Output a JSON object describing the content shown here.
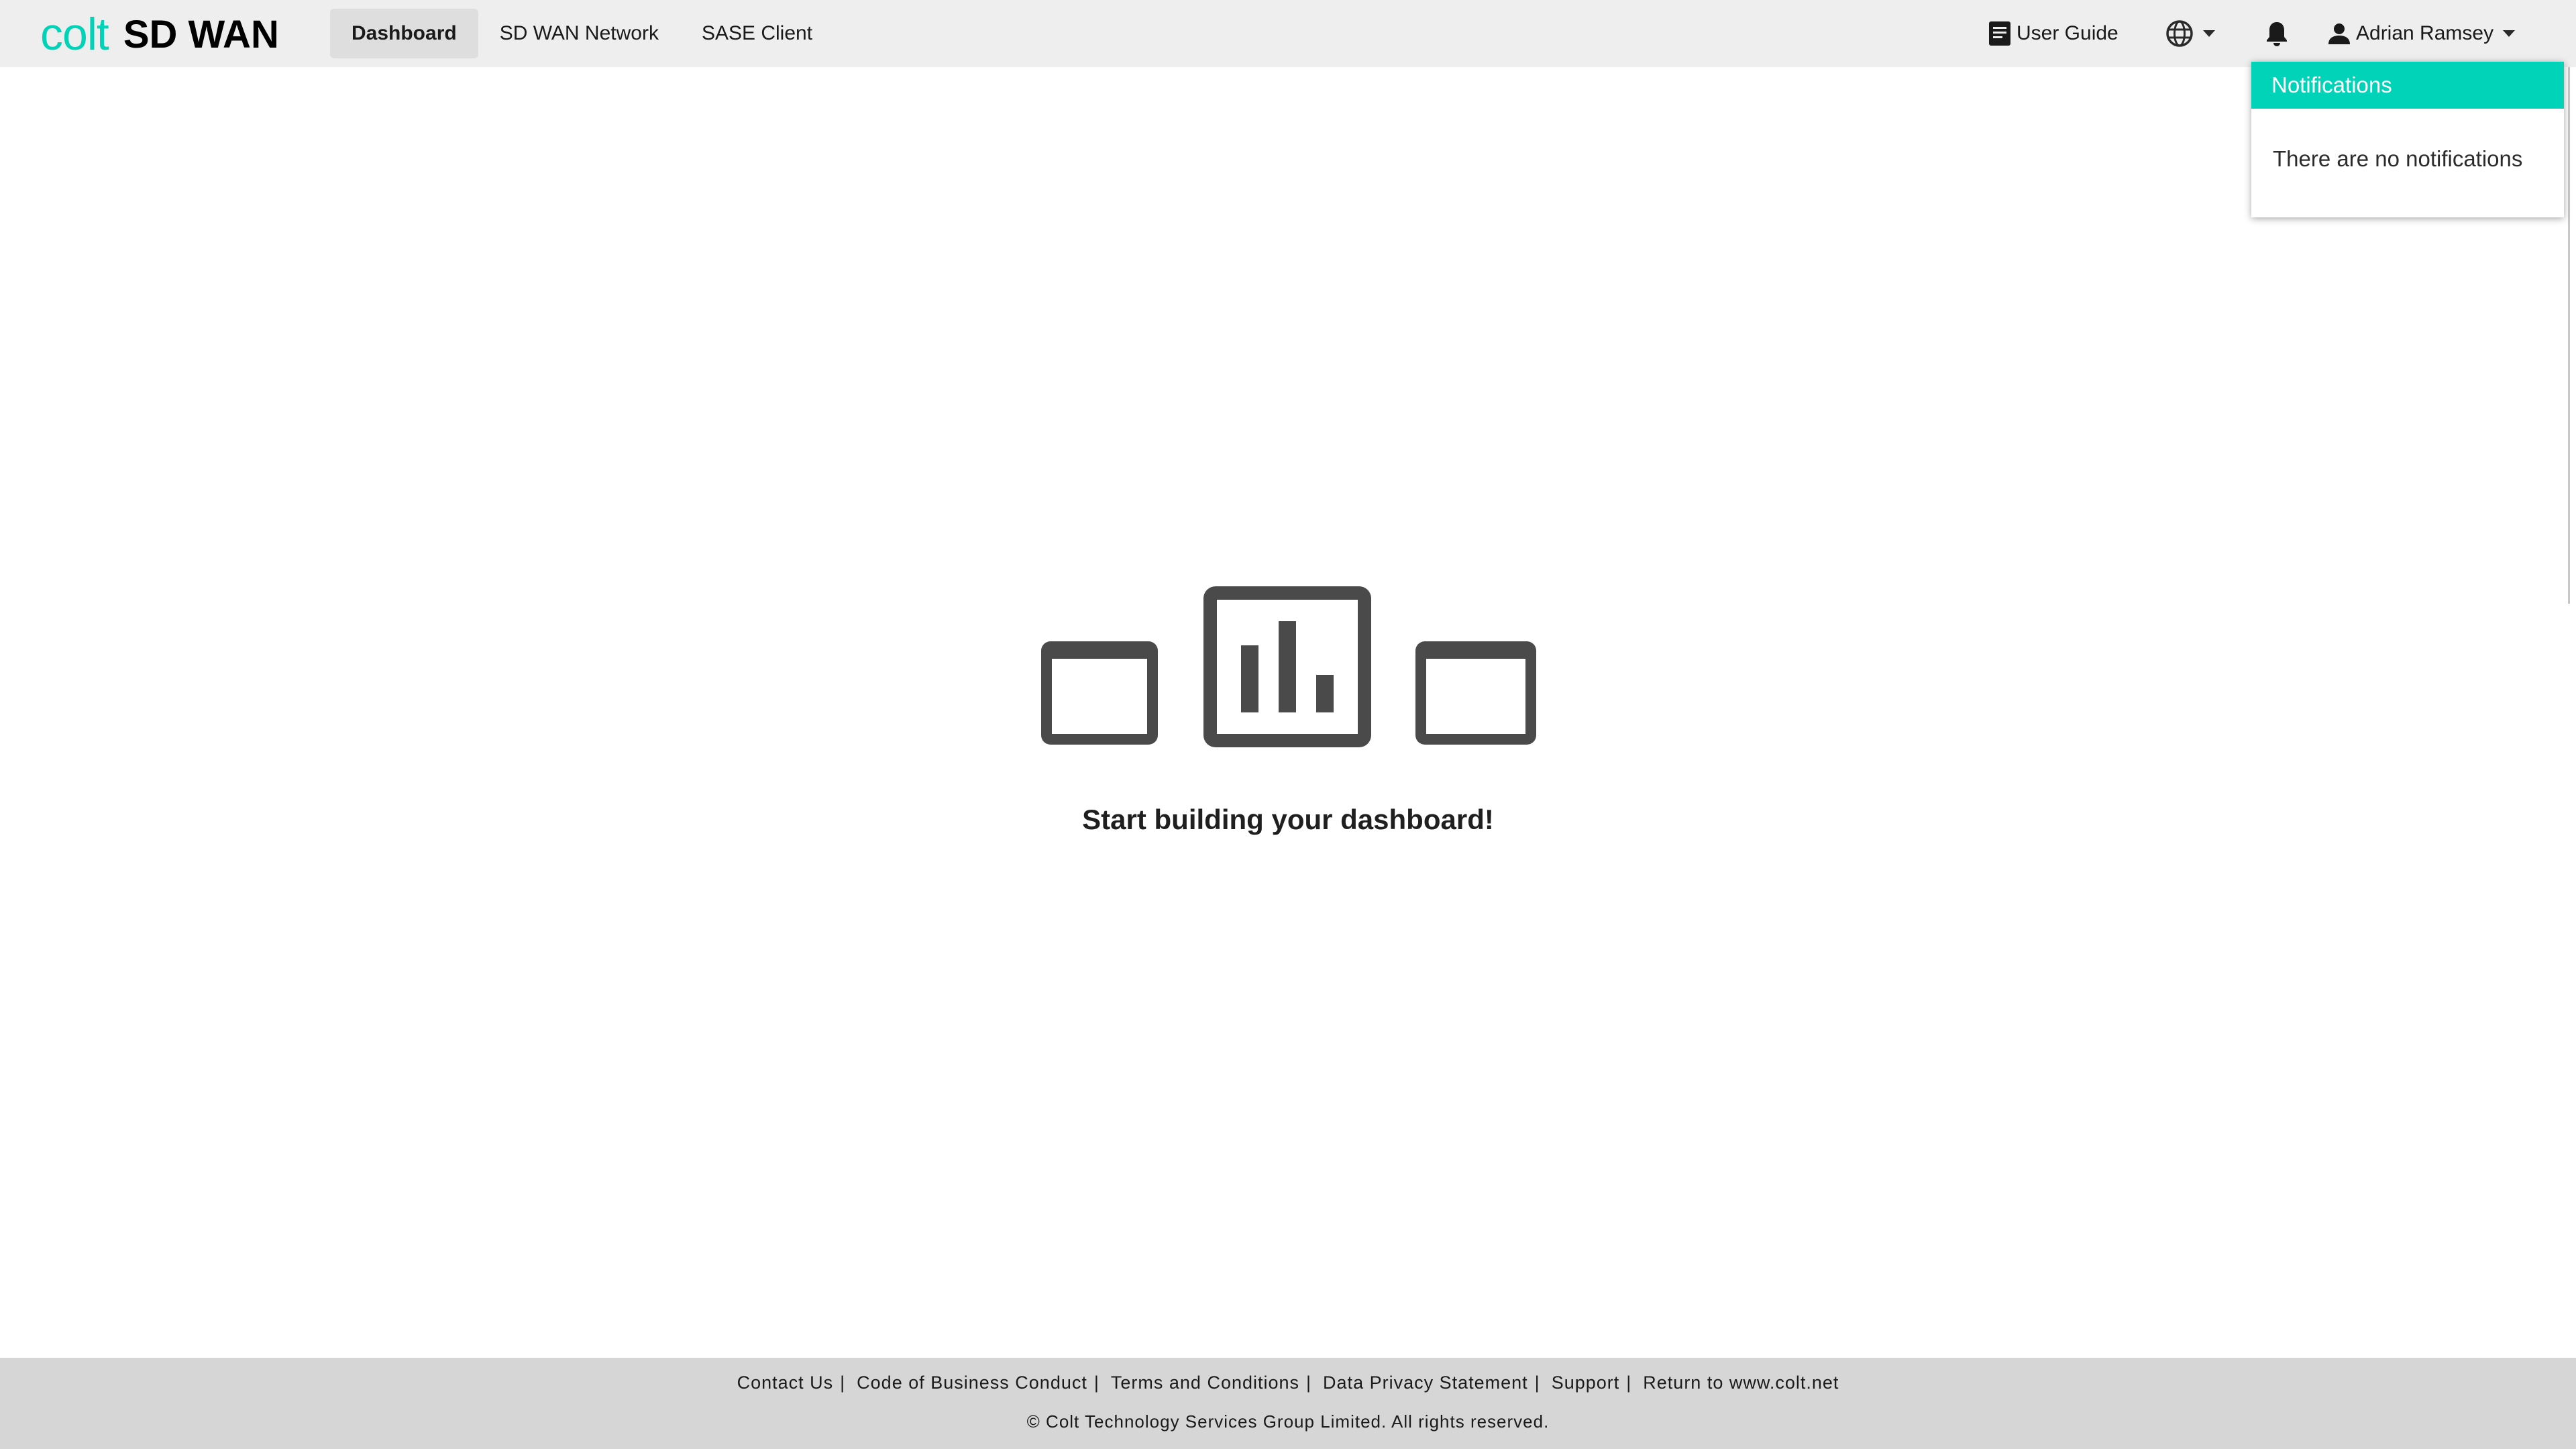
{
  "app": {
    "brand": "colt",
    "product": "SD WAN"
  },
  "nav": {
    "items": [
      {
        "label": "Dashboard",
        "active": true
      },
      {
        "label": "SD WAN Network",
        "active": false
      },
      {
        "label": "SASE Client",
        "active": false
      }
    ]
  },
  "header": {
    "user_guide_label": "User Guide",
    "language_icon": "globe-icon",
    "notifications_icon": "bell-icon",
    "user_name": "Adrian Ramsey"
  },
  "notifications": {
    "title": "Notifications",
    "empty_message": "There are no notifications"
  },
  "main": {
    "empty_state_text": "Start building your dashboard!"
  },
  "footer": {
    "links": [
      "Contact Us",
      "Code of Business Conduct",
      "Terms and Conditions",
      "Data Privacy Statement",
      "Support",
      "Return to www.colt.net"
    ],
    "copyright": "© Colt Technology Services Group Limited. All rights reserved."
  },
  "colors": {
    "accent": "#00d3b8",
    "topbar_bg": "#eeeeee",
    "footer_bg": "#d6d6d6",
    "icon_dark": "#4a4a4a"
  }
}
